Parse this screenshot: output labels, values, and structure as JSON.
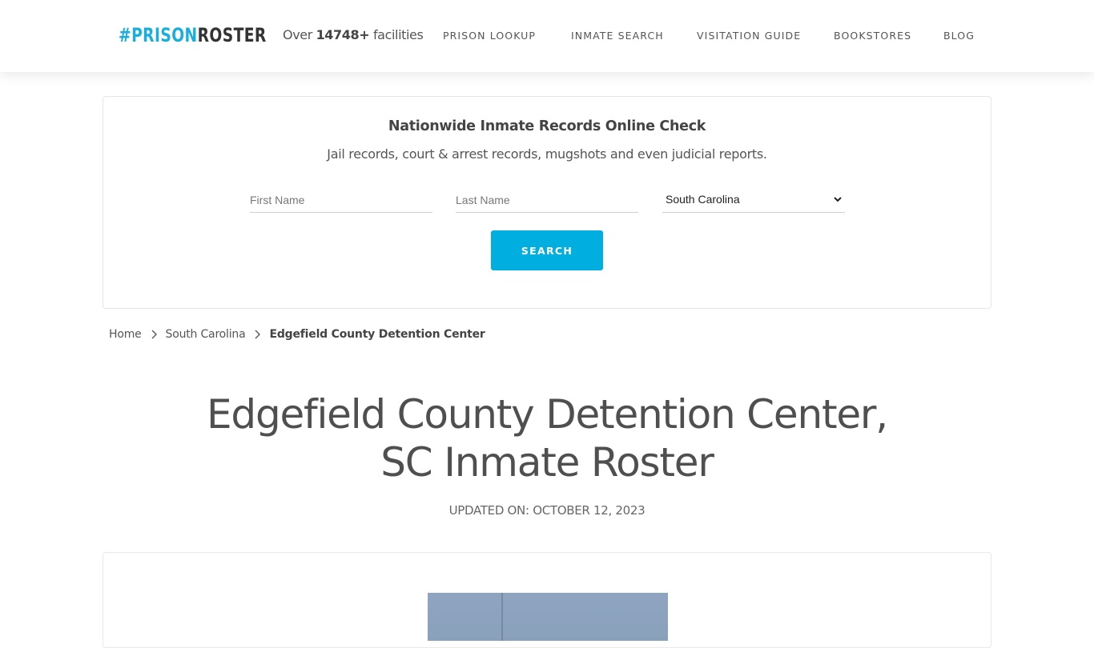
{
  "header": {
    "logo_part1": "#PRISON",
    "logo_part2": "ROSTER",
    "facilities_prefix": "Over",
    "facilities_count": "14748+",
    "facilities_suffix": "facilities",
    "nav": [
      {
        "label": "PRISON LOOKUP"
      },
      {
        "label": "INMATE SEARCH"
      },
      {
        "label": "VISITATION GUIDE"
      },
      {
        "label": "BOOKSTORES"
      },
      {
        "label": "BLOG"
      }
    ]
  },
  "search_card": {
    "title": "Nationwide Inmate Records Online Check",
    "subtitle": "Jail records, court & arrest records, mugshots and even judicial reports.",
    "first_name": {
      "value": "",
      "placeholder": "First Name"
    },
    "last_name": {
      "value": "",
      "placeholder": "Last Name"
    },
    "state_select": {
      "selected": "South Carolina"
    },
    "search_button": "SEARCH",
    "accent_color": "#00aee0"
  },
  "breadcrumb": {
    "items": [
      {
        "label": "Home"
      },
      {
        "label": "South Carolina"
      },
      {
        "label": "Edgefield County Detention Center"
      }
    ]
  },
  "page": {
    "title_line1": "Edgefield County Detention Center,",
    "title_line2": "SC Inmate Roster",
    "updated": "UPDATED ON: OCTOBER 12, 2023"
  },
  "colors": {
    "brand_blue": "#1aaedd",
    "brand_dark": "#333333",
    "text": "#555555"
  }
}
